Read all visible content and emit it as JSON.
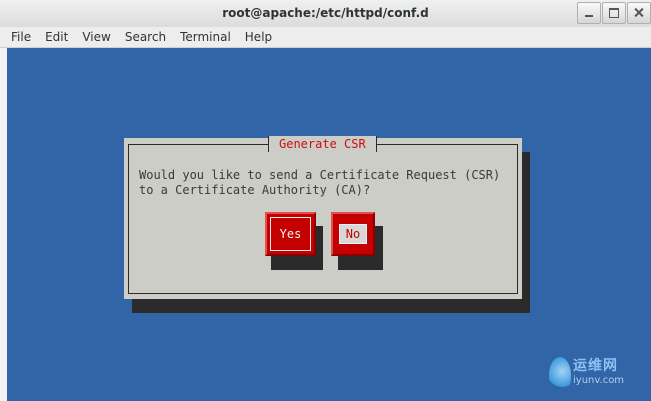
{
  "window": {
    "title": "root@apache:/etc/httpd/conf.d"
  },
  "menubar": {
    "items": [
      "File",
      "Edit",
      "View",
      "Search",
      "Terminal",
      "Help"
    ]
  },
  "dialog": {
    "title": "Generate CSR",
    "message": "Would you like to send a Certificate Request (CSR)\nto a Certificate Authority (CA)?",
    "yes_label": "Yes",
    "no_label": "No",
    "selected": "No"
  },
  "watermark": {
    "text": "运维网",
    "sub": "iyunv.com"
  },
  "colors": {
    "terminal_bg": "#3264a8",
    "dialog_bg": "#cdcdc8",
    "button_red": "#c40000",
    "title_red": "#cc1010"
  }
}
